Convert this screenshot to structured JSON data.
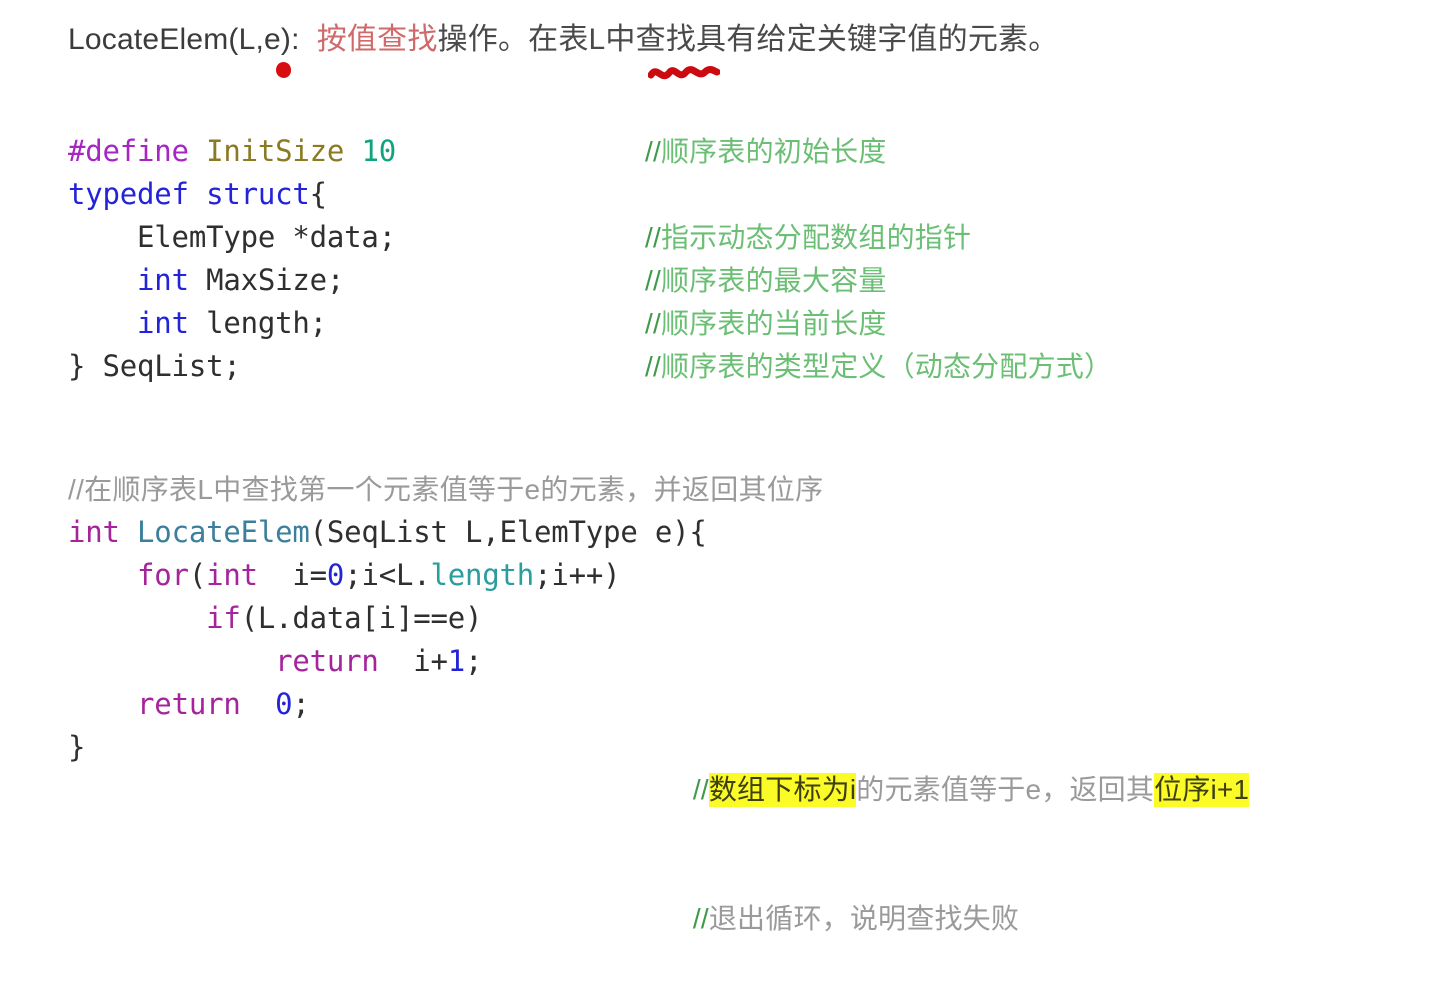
{
  "slide": {
    "heading": {
      "signature": "LocateElem(L,e):",
      "red_term": "按值查找",
      "rest": "操作。在表L中查找具有给定关键字值的元素。",
      "annotations": [
        {
          "name": "red-dot",
          "under": "e"
        },
        {
          "name": "red-squiggle",
          "under": "表L"
        }
      ]
    },
    "struct_code": {
      "lines": [
        [
          {
            "text": "#define",
            "color": "#a626c4"
          },
          {
            "text": " ",
            "color": "#2f2f2f"
          },
          {
            "text": "InitSize",
            "color": "#8a7a22"
          },
          {
            "text": " ",
            "color": "#2f2f2f"
          },
          {
            "text": "10",
            "color": "#10a37f"
          }
        ],
        [
          {
            "text": "typedef struct",
            "color": "#2323d8"
          },
          {
            "text": "{",
            "color": "#2f2f2f"
          }
        ],
        [
          {
            "text": "    ElemType *data;",
            "color": "#2f2f2f"
          }
        ],
        [
          {
            "text": "    ",
            "color": "#2f2f2f"
          },
          {
            "text": "int",
            "color": "#2323d8"
          },
          {
            "text": " MaxSize;",
            "color": "#2f2f2f"
          }
        ],
        [
          {
            "text": "    ",
            "color": "#2f2f2f"
          },
          {
            "text": "int",
            "color": "#2323d8"
          },
          {
            "text": " length;",
            "color": "#2f2f2f"
          }
        ],
        [
          {
            "text": "} SeqList;",
            "color": "#2f2f2f"
          }
        ]
      ]
    },
    "struct_comments": [
      "//顺序表的初始长度",
      "",
      "//指示动态分配数组的指针",
      "//顺序表的最大容量",
      "//顺序表的当前长度",
      "//顺序表的类型定义（动态分配方式）"
    ],
    "function_note": "//在顺序表L中查找第一个元素值等于e的元素，并返回其位序",
    "function_code": {
      "lines": [
        [],
        [
          {
            "text": "int",
            "color": "#a6249b"
          },
          {
            "text": " ",
            "color": "#2f2f2f"
          },
          {
            "text": "LocateElem",
            "color": "#3a7f9b"
          },
          {
            "text": "(SeqList L,ElemType e){",
            "color": "#2f2f2f"
          }
        ],
        [
          {
            "text": "    ",
            "color": "#2f2f2f"
          },
          {
            "text": "for",
            "color": "#a6249b"
          },
          {
            "text": "(",
            "color": "#2f2f2f"
          },
          {
            "text": "int",
            "color": "#a6249b"
          },
          {
            "text": "  i=",
            "color": "#2f2f2f"
          },
          {
            "text": "0",
            "color": "#2323d8"
          },
          {
            "text": ";i<L.",
            "color": "#2f2f2f"
          },
          {
            "text": "length",
            "color": "#2a9d9d"
          },
          {
            "text": ";i++)",
            "color": "#2f2f2f"
          }
        ],
        [
          {
            "text": "        ",
            "color": "#2f2f2f"
          },
          {
            "text": "if",
            "color": "#a6249b"
          },
          {
            "text": "(L.data[i]==e)",
            "color": "#2f2f2f"
          }
        ],
        [
          {
            "text": "            ",
            "color": "#2f2f2f"
          },
          {
            "text": "return",
            "color": "#a6249b"
          },
          {
            "text": "  i+",
            "color": "#2f2f2f"
          },
          {
            "text": "1",
            "color": "#2323d8"
          },
          {
            "text": ";",
            "color": "#2f2f2f"
          }
        ],
        [
          {
            "text": "    ",
            "color": "#2f2f2f"
          },
          {
            "text": "return",
            "color": "#a6249b"
          },
          {
            "text": "  ",
            "color": "#2f2f2f"
          },
          {
            "text": "0",
            "color": "#2323d8"
          },
          {
            "text": ";",
            "color": "#2f2f2f"
          }
        ],
        [
          {
            "text": "}",
            "color": "#2f2f2f"
          }
        ]
      ]
    },
    "function_comments": {
      "return_line": {
        "prefix": "//",
        "highlight_1": "数组下标为i",
        "middle": "的元素值等于e，返回其",
        "highlight_2": "位序i+1"
      },
      "exit_line": "//退出循环，说明查找失败"
    },
    "colors": {
      "background": "#ffffff",
      "heading_text": "#3b3b3b",
      "heading_accent": "#d06a6a",
      "ink_red": "#d80d12",
      "comment_green": "#3f9b4a",
      "comment_gray": "#9a9a9a",
      "highlight_yellow": "#fbfb28",
      "preprocessor": "#a626c4",
      "macro_name": "#8a7a22",
      "number_teal": "#10a37f",
      "keyword_blue": "#2323d8",
      "keyword_magenta": "#a6249b",
      "function_name": "#3a7f9b",
      "member_teal": "#2a9d9d"
    }
  }
}
